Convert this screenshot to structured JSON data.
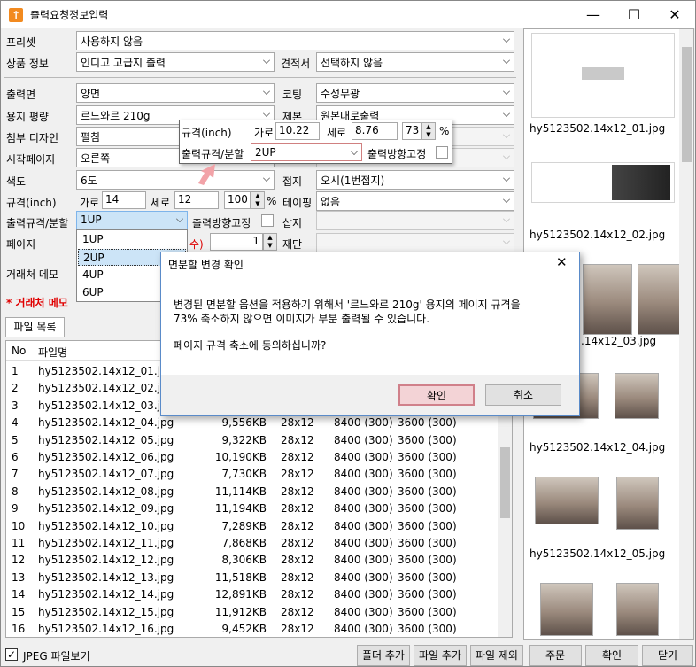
{
  "window": {
    "title": "출력요청정보입력"
  },
  "form": {
    "preset_label": "프리셋",
    "preset_value": "사용하지 않음",
    "product_label": "상품 정보",
    "product_value": "인디고 고급지 출력",
    "quote_label": "견적서",
    "quote_value": "선택하지 않음",
    "print_side_label": "출력면",
    "print_side_value": "양면",
    "coating_label": "코팅",
    "coating_value": "수성무광",
    "paper_label": "용지 평량",
    "paper_value": "르느와르 210g",
    "binding_label": "제본",
    "binding_value": "원본대로출력",
    "attach_label": "첨부 디자인",
    "attach_value": "펼침",
    "start_page_label": "시작페이지",
    "start_page_value": "오른쪽",
    "color_label": "색도",
    "color_value": "6도",
    "fold_label": "접지",
    "fold_value": "오시(1번접지)",
    "size_label": "규격(inch)",
    "width_label": "가로",
    "width_value": "14",
    "height_label": "세로",
    "height_value": "12",
    "scale_value": "100",
    "percent": "%",
    "taping_label": "테이핑",
    "taping_value": "없음",
    "split_label": "출력규격/분할",
    "split_value": "1UP",
    "fix_orient_label": "출력방향고정",
    "insert_label": "삽지",
    "pages_label": "페이지",
    "pages_count": "1",
    "pages_note": "수)",
    "cutting_label": "재단",
    "memo_label": "거래처 메모",
    "warning_text": "* 거래처 메모"
  },
  "popup": {
    "size_label": "규격(inch)",
    "width_label": "가로",
    "width_value": "10.22",
    "height_label": "세로",
    "height_value": "8.76",
    "scale_value": "73",
    "percent": "%",
    "split_label": "출력규격/분할",
    "split_value": "2UP",
    "fix_orient_label": "출력방향고정"
  },
  "dropdown": {
    "options": [
      "1UP",
      "2UP",
      "4UP",
      "6UP"
    ],
    "highlighted": "2UP"
  },
  "file_tab": "파일 목록",
  "table": {
    "headers": [
      "No",
      "파일명"
    ],
    "rows": [
      [
        "1",
        "hy5123502.14x12_01.jpg",
        "",
        "",
        "",
        ""
      ],
      [
        "2",
        "hy5123502.14x12_02.jpg",
        "",
        "",
        "",
        ""
      ],
      [
        "3",
        "hy5123502.14x12_03.jpg",
        "",
        "",
        "",
        ""
      ],
      [
        "4",
        "hy5123502.14x12_04.jpg",
        "9,556KB",
        "28x12",
        "8400 (300)",
        "3600 (300)"
      ],
      [
        "5",
        "hy5123502.14x12_05.jpg",
        "9,322KB",
        "28x12",
        "8400 (300)",
        "3600 (300)"
      ],
      [
        "6",
        "hy5123502.14x12_06.jpg",
        "10,190KB",
        "28x12",
        "8400 (300)",
        "3600 (300)"
      ],
      [
        "7",
        "hy5123502.14x12_07.jpg",
        "7,730KB",
        "28x12",
        "8400 (300)",
        "3600 (300)"
      ],
      [
        "8",
        "hy5123502.14x12_08.jpg",
        "11,114KB",
        "28x12",
        "8400 (300)",
        "3600 (300)"
      ],
      [
        "9",
        "hy5123502.14x12_09.jpg",
        "11,194KB",
        "28x12",
        "8400 (300)",
        "3600 (300)"
      ],
      [
        "10",
        "hy5123502.14x12_10.jpg",
        "7,289KB",
        "28x12",
        "8400 (300)",
        "3600 (300)"
      ],
      [
        "11",
        "hy5123502.14x12_11.jpg",
        "7,868KB",
        "28x12",
        "8400 (300)",
        "3600 (300)"
      ],
      [
        "12",
        "hy5123502.14x12_12.jpg",
        "8,306KB",
        "28x12",
        "8400 (300)",
        "3600 (300)"
      ],
      [
        "13",
        "hy5123502.14x12_13.jpg",
        "11,518KB",
        "28x12",
        "8400 (300)",
        "3600 (300)"
      ],
      [
        "14",
        "hy5123502.14x12_14.jpg",
        "12,891KB",
        "28x12",
        "8400 (300)",
        "3600 (300)"
      ],
      [
        "15",
        "hy5123502.14x12_15.jpg",
        "11,912KB",
        "28x12",
        "8400 (300)",
        "3600 (300)"
      ],
      [
        "16",
        "hy5123502.14x12_16.jpg",
        "9,452KB",
        "28x12",
        "8400 (300)",
        "3600 (300)"
      ]
    ]
  },
  "thumbs": [
    "hy5123502.14x12_01.jpg",
    "hy5123502.14x12_02.jpg",
    ".14x12_03.jpg",
    "hy5123502.14x12_04.jpg",
    "hy5123502.14x12_05.jpg"
  ],
  "dialog": {
    "title": "면분할 변경 확인",
    "line1": "변경된 면분할 옵션을 적용하기 위해서 '르느와르 210g' 용지의 페이지 규격을",
    "line2": "73% 축소하지 않으면 이미지가 부분 출력될 수 있습니다.",
    "line3": "페이지 규격 축소에 동의하십니까?",
    "ok": "확인",
    "cancel": "취소"
  },
  "bottom": {
    "jpeg_label": "JPEG 파일보기",
    "add_folder": "폴더 추가",
    "add_file": "파일 추가",
    "remove_file": "파일 제외",
    "order": "주문",
    "confirm": "확인",
    "close": "닫기"
  }
}
